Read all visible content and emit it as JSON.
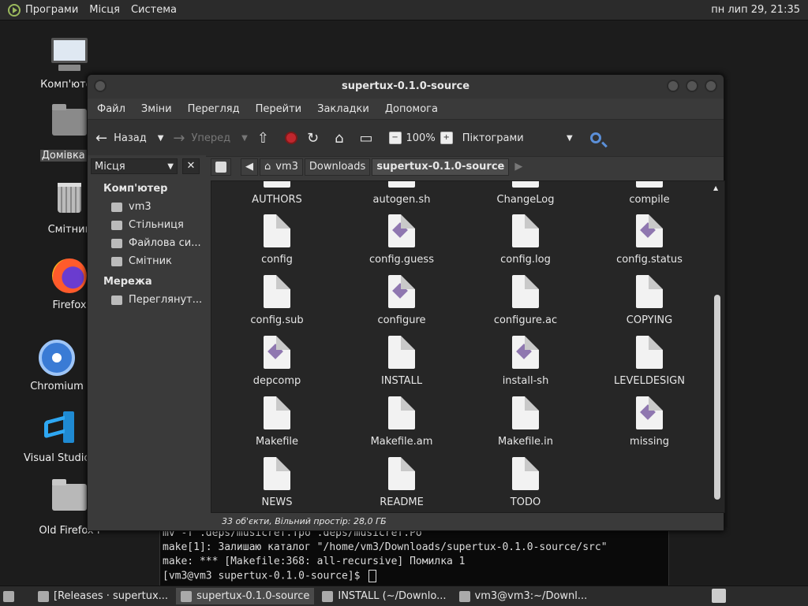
{
  "top_panel": {
    "menus": [
      "Програми",
      "Місця",
      "Система"
    ],
    "clock": "пн лип 29, 21:35"
  },
  "desktop": {
    "icons": [
      {
        "label": "Комп'ютер",
        "icon": "computer-icon"
      },
      {
        "label": "Домівка vi",
        "icon": "home-folder-icon"
      },
      {
        "label": "Смітник",
        "icon": "trash-icon"
      },
      {
        "label": "Firefox",
        "icon": "firefox-icon"
      },
      {
        "label": "Chromium",
        "icon": "chromium-icon"
      },
      {
        "label": "Visual Studio Co",
        "icon": "vscode-icon"
      },
      {
        "label": "Old Firefox I",
        "icon": "folder-icon"
      }
    ]
  },
  "terminal": {
    "lines": [
      "mv -f .deps/musicref.Tpo .deps/musicref.Po",
      "make[1]: Залишаю каталог \"/home/vm3/Downloads/supertux-0.1.0-source/src\"",
      "make: *** [Makefile:368: all-recursive] Помилка 1",
      "[vm3@vm3 supertux-0.1.0-source]$ "
    ]
  },
  "file_manager": {
    "title": "supertux-0.1.0-source",
    "menubar": [
      "Файл",
      "Зміни",
      "Перегляд",
      "Перейти",
      "Закладки",
      "Допомога"
    ],
    "toolbar": {
      "back": "Назад",
      "forward": "Уперед",
      "zoom": "100%",
      "view_mode": "Піктограми"
    },
    "sidebar": {
      "selector": "Місця",
      "sections": [
        {
          "heading": "Комп'ютер",
          "items": [
            "vm3",
            "Стільниця",
            "Файлова си...",
            "Смітник"
          ]
        },
        {
          "heading": "Мережа",
          "items": [
            "Переглянут..."
          ]
        }
      ]
    },
    "path": [
      "vm3",
      "Downloads",
      "supertux-0.1.0-source"
    ],
    "files": [
      {
        "name": "AUTHORS",
        "type": "text"
      },
      {
        "name": "autogen.sh",
        "type": "script"
      },
      {
        "name": "ChangeLog",
        "type": "text"
      },
      {
        "name": "compile",
        "type": "script"
      },
      {
        "name": "config",
        "type": "text"
      },
      {
        "name": "config.guess",
        "type": "script"
      },
      {
        "name": "config.log",
        "type": "text"
      },
      {
        "name": "config.status",
        "type": "script"
      },
      {
        "name": "config.sub",
        "type": "text"
      },
      {
        "name": "configure",
        "type": "script"
      },
      {
        "name": "configure.ac",
        "type": "text"
      },
      {
        "name": "COPYING",
        "type": "text"
      },
      {
        "name": "depcomp",
        "type": "script"
      },
      {
        "name": "INSTALL",
        "type": "text"
      },
      {
        "name": "install-sh",
        "type": "script"
      },
      {
        "name": "LEVELDESIGN",
        "type": "text"
      },
      {
        "name": "Makefile",
        "type": "text"
      },
      {
        "name": "Makefile.am",
        "type": "text"
      },
      {
        "name": "Makefile.in",
        "type": "text"
      },
      {
        "name": "missing",
        "type": "script"
      },
      {
        "name": "NEWS",
        "type": "text"
      },
      {
        "name": "README",
        "type": "text"
      },
      {
        "name": "TODO",
        "type": "text"
      }
    ],
    "status": "33 об'єкти, Вільний простір: 28,0 ГБ"
  },
  "taskbar": {
    "tasks": [
      {
        "label": "[Releases · supertux...",
        "active": false
      },
      {
        "label": "supertux-0.1.0-source",
        "active": true
      },
      {
        "label": "INSTALL (~/Downlo...",
        "active": false
      },
      {
        "label": "vm3@vm3:~/Downl...",
        "active": false
      }
    ]
  }
}
